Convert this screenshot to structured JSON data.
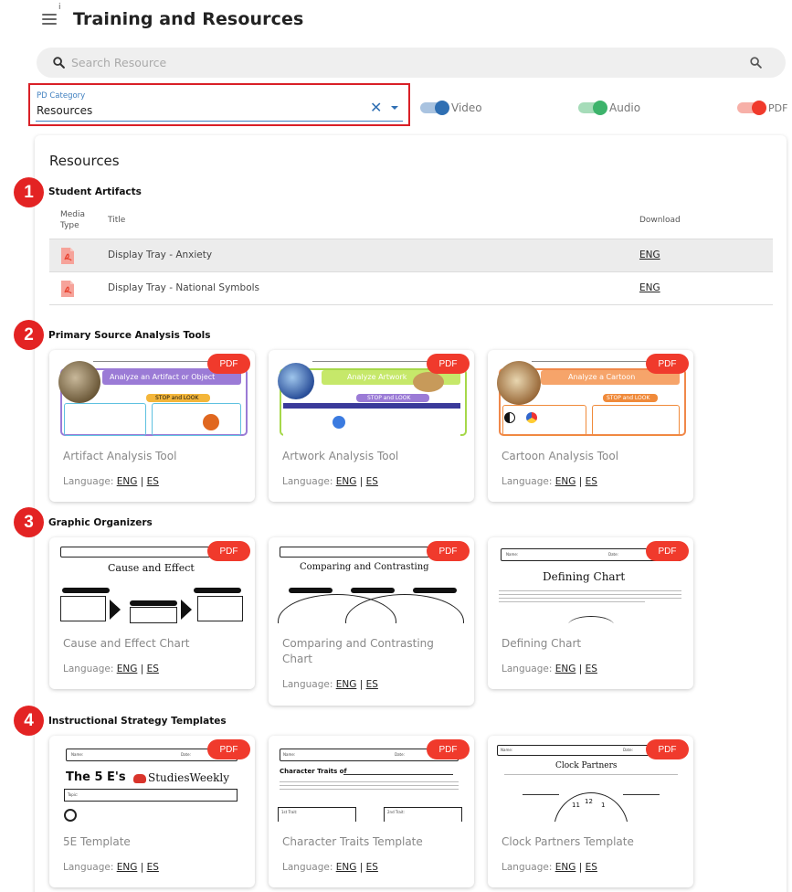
{
  "header": {
    "title": "Training and Resources",
    "info_glyph": "i",
    "menu_icon": "hamburger-icon"
  },
  "search": {
    "placeholder": "Search Resource",
    "value": ""
  },
  "pd_category": {
    "label": "PD Category",
    "value": "Resources"
  },
  "toggles": [
    {
      "label": "Video",
      "on": true,
      "color": "#2f6fb3",
      "track": "#a9c3e0"
    },
    {
      "label": "Audio",
      "on": true,
      "color": "#3db36b",
      "track": "#a6dcb9"
    },
    {
      "label": "PDF",
      "on": true,
      "color": "#f03a2c",
      "track": "#f7b0a8"
    }
  ],
  "panel": {
    "title": "Resources"
  },
  "annotations": [
    "1",
    "2",
    "3",
    "4"
  ],
  "student_artifacts": {
    "title": "Student Artifacts",
    "columns": {
      "media_type": "Media Type",
      "title": "Title",
      "download": "Download"
    },
    "rows": [
      {
        "title": "Display Tray - Anxiety",
        "download": "ENG",
        "highlighted": true
      },
      {
        "title": "Display Tray - National Symbols",
        "download": "ENG",
        "highlighted": false
      }
    ]
  },
  "primary_tools": {
    "title": "Primary Source Analysis Tools",
    "cards": [
      {
        "badge": "PDF",
        "title": "Artifact Analysis Tool",
        "language_label": "Language:",
        "eng": "ENG",
        "sep": "|",
        "es": "ES",
        "thumb_heading": "Analyze an Artifact or Object",
        "thumb_sub": "STOP and LOOK",
        "thumb_color": "#9b7bd6"
      },
      {
        "badge": "PDF",
        "title": "Artwork Analysis Tool",
        "language_label": "Language:",
        "eng": "ENG",
        "sep": "|",
        "es": "ES",
        "thumb_heading": "Analyze Artwork",
        "thumb_sub": "STOP and LOOK",
        "thumb_color": "#a6d84a"
      },
      {
        "badge": "PDF",
        "title": "Cartoon Analysis Tool",
        "language_label": "Language:",
        "eng": "ENG",
        "sep": "|",
        "es": "ES",
        "thumb_heading": "Analyze a Cartoon",
        "thumb_sub": "STOP and LOOK",
        "thumb_color": "#f0884a"
      }
    ]
  },
  "graphic_organizers": {
    "title": "Graphic Organizers",
    "cards": [
      {
        "badge": "PDF",
        "title": "Cause and Effect Chart",
        "language_label": "Language:",
        "eng": "ENG",
        "sep": "|",
        "es": "ES",
        "thumb_heading": "Cause and Effect",
        "thumb_labels": [
          "Causes",
          "Situation",
          "Effects"
        ]
      },
      {
        "badge": "PDF",
        "title": "Comparing and Contrasting Chart",
        "language_label": "Language:",
        "eng": "ENG",
        "sep": "|",
        "es": "ES",
        "thumb_heading": "Comparing and Contrasting",
        "thumb_labels": [
          "Subject 1",
          "Similarities",
          "Subject 2"
        ]
      },
      {
        "badge": "PDF",
        "title": "Defining Chart",
        "language_label": "Language:",
        "eng": "ENG",
        "sep": "|",
        "es": "ES",
        "thumb_heading": "Defining Chart",
        "thumb_labels": [
          "Name:",
          "Date:"
        ]
      }
    ]
  },
  "strategy_templates": {
    "title": "Instructional Strategy Templates",
    "cards": [
      {
        "badge": "PDF",
        "title": "5E Template",
        "language_label": "Language:",
        "eng": "ENG",
        "sep": "|",
        "es": "ES",
        "thumb_heading": "The 5 E's",
        "thumb_brand": "StudiesWeekly",
        "thumb_labels": [
          "Name:",
          "Date:",
          "Topic:"
        ]
      },
      {
        "badge": "PDF",
        "title": "Character Traits Template",
        "language_label": "Language:",
        "eng": "ENG",
        "sep": "|",
        "es": "ES",
        "thumb_heading": "Character Traits of",
        "thumb_labels": [
          "Name:",
          "Date:",
          "1st Trait:",
          "2nd Trait:"
        ]
      },
      {
        "badge": "PDF",
        "title": "Clock Partners Template",
        "language_label": "Language:",
        "eng": "ENG",
        "sep": "|",
        "es": "ES",
        "thumb_heading": "Clock Partners",
        "thumb_labels": [
          "Name:",
          "Date:",
          "12",
          "11",
          "1"
        ]
      }
    ]
  }
}
